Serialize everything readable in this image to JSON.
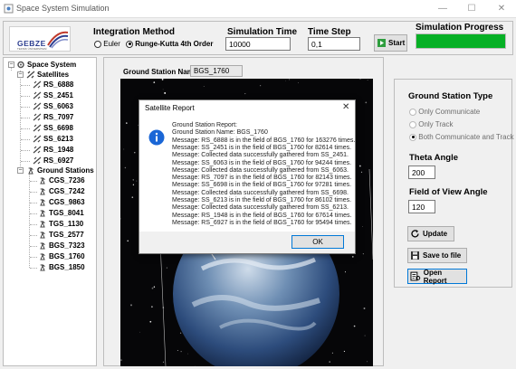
{
  "window": {
    "title": "Space System Simulation"
  },
  "toolbar": {
    "logo_text": "GEBZE",
    "logo_sub": "TEKNİK ÜNİVERSİTESİ",
    "integration_title": "Integration Method",
    "methods": [
      "Euler",
      "Runge-Kutta 4th Order"
    ],
    "selected_method": "Runge-Kutta 4th Order",
    "sim_time_label": "Simulation Time",
    "sim_time_value": "10000",
    "time_step_label": "Time Step",
    "time_step_value": "0,1",
    "start_label": "Start",
    "progress_label": "Simulation Progress",
    "progress_value": 1.0,
    "progress_color": "#06b025"
  },
  "tree": {
    "root": "Space System",
    "satellites_label": "Satellites",
    "satellites": [
      "RS_6888",
      "SS_2451",
      "SS_6063",
      "RS_7097",
      "SS_6698",
      "SS_6213",
      "RS_1948",
      "RS_6927"
    ],
    "stations_label": "Ground Stations",
    "stations": [
      "CGS_7236",
      "CGS_7242",
      "CGS_9863",
      "TGS_8041",
      "TGS_1130",
      "TGS_2577",
      "BGS_7323",
      "BGS_1760",
      "BGS_1850"
    ]
  },
  "center": {
    "gs_name_label": "Ground Station Name:",
    "gs_name_value": "BGS_1760"
  },
  "right": {
    "type_title": "Ground Station Type",
    "types": [
      "Only Communicate",
      "Only Track",
      "Both Communicate and Track"
    ],
    "selected_type": "Both Communicate and Track",
    "theta_label": "Theta Angle",
    "theta_value": "200",
    "fov_label": "Field of View Angle",
    "fov_value": "120",
    "update_label": "Update",
    "save_label": "Save to file",
    "open_label": "Open Report"
  },
  "dialog": {
    "title": "Satellite Report",
    "ok_label": "OK",
    "lines": [
      "Ground Station Report:",
      "Ground Station Name: BGS_1760",
      "Message: RS_6888 is in the field of BGS_1760 for 163276 times.",
      "Message: SS_2451 is in the field of BGS_1760 for 82614 times.",
      "Message: Collected data successfully gathered from SS_2451.",
      "Message: SS_6063 is in the field of BGS_1760 for 94244 times.",
      "Message: Collected data successfully gathered from SS_6063.",
      "Message: RS_7097 is in the field of BGS_1760 for 82143 times.",
      "Message: SS_6698 is in the field of BGS_1760 for 97281 times.",
      "Message: Collected data successfully gathered from SS_6698.",
      "Message: SS_6213 is in the field of BGS_1760 for 86102 times.",
      "Message: Collected data successfully gathered from SS_6213.",
      "Message: RS_1948 is in the field of BGS_1760 for 67614 times.",
      "Message: RS_6927 is in the field of BGS_1760 for 95494 times."
    ]
  }
}
